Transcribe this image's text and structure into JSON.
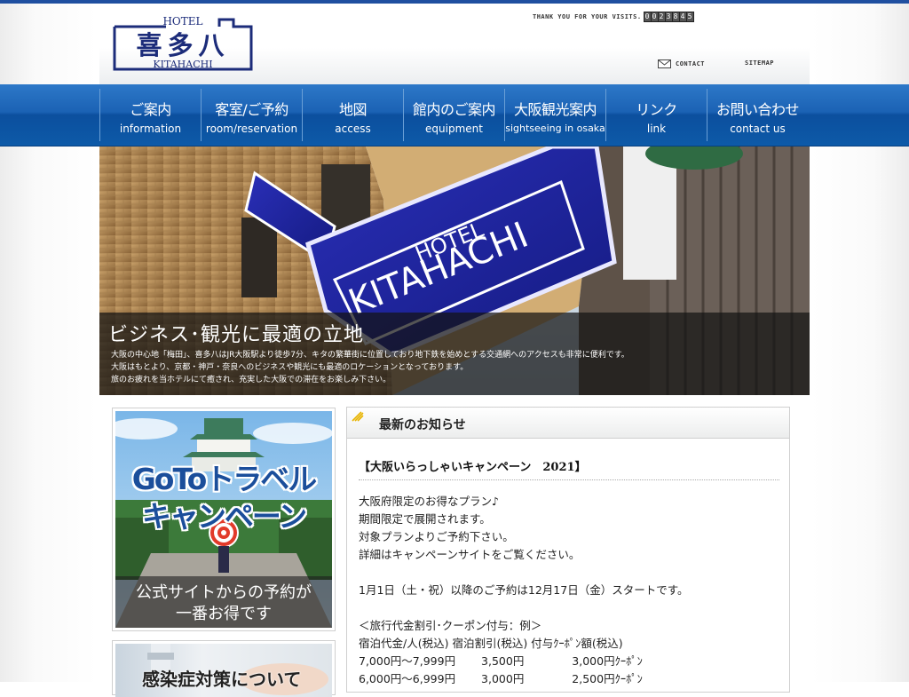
{
  "header": {
    "logo": {
      "top": "HOTEL",
      "kanji": "喜多八",
      "bottom": "KITAHACHI"
    },
    "visits_label": "THANK YOU FOR YOUR VISITS.",
    "counter": [
      "0",
      "0",
      "2",
      "3",
      "8",
      "4",
      "5"
    ],
    "contact_label": "CONTACT",
    "sitemap_label": "SITEMAP"
  },
  "nav": [
    {
      "jp": "ご案内",
      "en": "information"
    },
    {
      "jp": "客室/ご予約",
      "en": "room/reservation"
    },
    {
      "jp": "地図",
      "en": "access"
    },
    {
      "jp": "館内のご案内",
      "en": "equipment"
    },
    {
      "jp": "大阪観光案内",
      "en": "sightseeing in osaka"
    },
    {
      "jp": "リンク",
      "en": "link"
    },
    {
      "jp": "お問い合わせ",
      "en": "contact us"
    }
  ],
  "hero": {
    "sign_top": "HOTEL",
    "sign_main": "KITAHACHI",
    "title": "ビジネス･観光に最適の立地",
    "desc1": "大阪の中心地「梅田」、喜多八はJR大阪駅より徒歩7分、キタの繁華街に位置しており地下鉄を始めとする交通網へのアクセスも非常に便利です。",
    "desc2": "大阪はもとより、京都・神戸・奈良へのビジネスや観光にも最適のロケーションとなっております。",
    "desc3": "旅のお疲れを当ホテルにて癒され、充実した大阪での滞在をお楽しみ下さい。"
  },
  "banner_goto": {
    "line1": "GoToトラベル",
    "line2": "キャンペーン",
    "sub1": "公式サイトからの予約が",
    "sub2": "一番お得です"
  },
  "banner_covid": {
    "text": "感染症対策について"
  },
  "news": {
    "title": "最新のお知らせ",
    "headline": "【大阪いらっしゃいキャンペーン　2021】",
    "body": "大阪府限定のお得なプラン♪\n期間限定で展開されます。\n対象プランよりご予約下さい。\n詳細はキャンペーンサイトをご覧ください。\n\n1月1日（土・祝）以降のご予約は12月17日（金）スタートです。\n\n＜旅行代金割引･クーポン付与：例＞\n宿泊代金/人(税込) 宿泊割引(税込) 付与ｸｰﾎﾟﾝ額(税込)\n7,000円〜7,999円　　 3,500円　　　　 3,000円ｸｰﾎﾟﾝ\n6,000円〜6,999円　　 3,000円　　　　 2,500円ｸｰﾎﾟﾝ"
  },
  "colors": {
    "nav_blue": "#1b62b4",
    "logo_navy": "#1c2c7a",
    "top_line": "#1f4fa0"
  }
}
